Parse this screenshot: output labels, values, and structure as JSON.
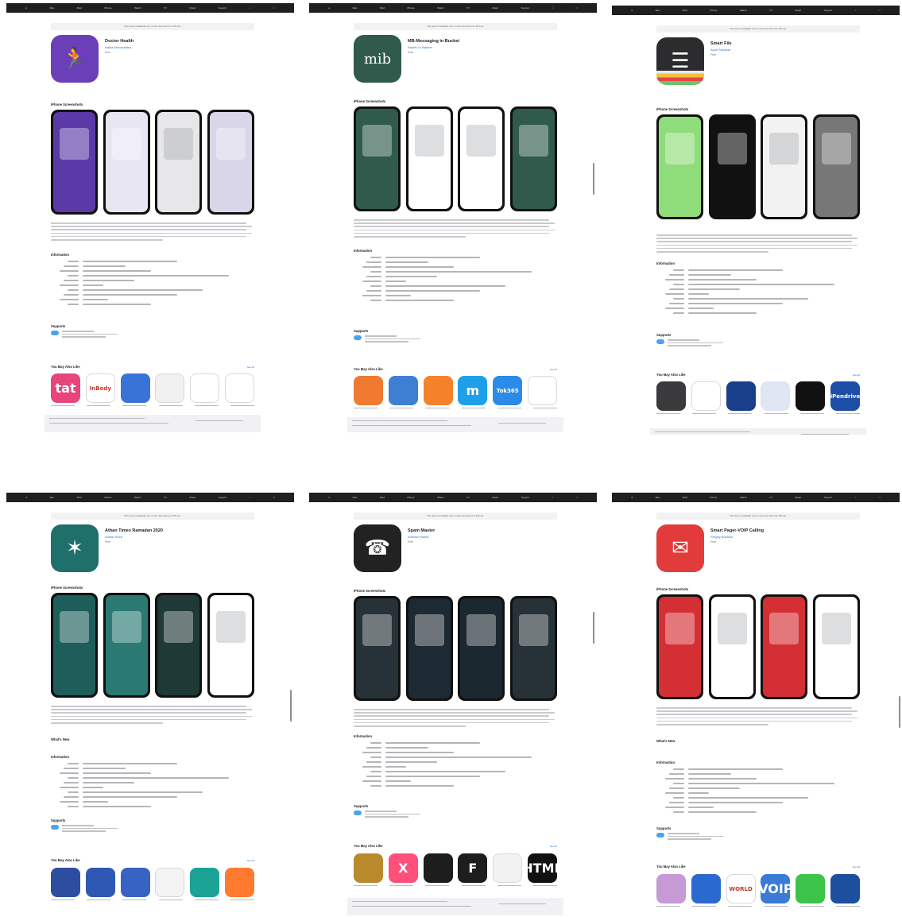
{
  "nav": [
    "",
    "Mac",
    "iPad",
    "iPhone",
    "Watch",
    "TV",
    "Music",
    "Support",
    "",
    ""
  ],
  "screenshots_heading": "iPhone Screenshots",
  "information_heading": "Information",
  "supports_heading": "Supports",
  "also_like_heading": "You May Also Like",
  "whats_new_heading": "What's New",
  "see_all": "See All",
  "panels": [
    {
      "banner": "This app is available only on the App Store for iPhone.",
      "title": "Doctor Health",
      "developer": "Haiaa Almowahiba",
      "price": "Free",
      "icon": "running-figure-icon",
      "icon_color": "#6b3fb8",
      "shot_colors": [
        "#5b3aa8",
        "#e9e6f3",
        "#e7e7ea",
        "#d9d6ea"
      ]
    },
    {
      "banner": "This app is available only on the App Store for iPhone.",
      "title": "MB-Messaging in Bucket",
      "developer": "Saheb Lo Bakeer",
      "price": "Free",
      "icon": "mib-logo-icon",
      "icon_color": "#2f5a4c",
      "shot_colors": [
        "#2f5a4c",
        "#ffffff",
        "#ffffff",
        "#2f5a4c"
      ]
    },
    {
      "banner": "This app is available only on the App Store for iPhone.",
      "title": "Smart File",
      "developer": "Ayub Sobahar",
      "price": "Free",
      "icon": "document-icon",
      "icon_color": "#2c2c2e",
      "shot_colors": [
        "#8fdc7a",
        "#111111",
        "#f2f2f2",
        "#777777"
      ]
    },
    {
      "banner": "This app is available only on the App Store for iPhone.",
      "title": "Athan Times Ramadan 2020",
      "developer": "Anwar Raza",
      "price": "Free",
      "icon": "compass-mosque-icon",
      "icon_color": "#1f6f6a",
      "shot_colors": [
        "#1e5e5a",
        "#2a7a73",
        "#1f3a36",
        "#ffffff"
      ]
    },
    {
      "banner": "This app is available only on the App Store for iPhone.",
      "title": "Spam Master",
      "developer": "Andrew Hamdi",
      "price": "Free",
      "icon": "phone-shield-icon",
      "icon_color": "#222222",
      "shot_colors": [
        "#263238",
        "#1e2a33",
        "#1c2830",
        "#263238"
      ]
    },
    {
      "banner": "This app is available only on the App Store for iPhone.",
      "title": "Smart Pager-VOIP Calling",
      "developer": "Sergey Bushkin",
      "price": "Free",
      "icon": "pager-phone-icon",
      "icon_color": "#e23b3b",
      "shot_colors": [
        "#d42f34",
        "#ffffff",
        "#d42f34",
        "#ffffff"
      ]
    }
  ],
  "also_like": [
    [
      {
        "name": "tat",
        "color": "#e8457b"
      },
      {
        "name": "InBody",
        "color": "#ffffff"
      },
      {
        "name": "",
        "color": "#3a73d8"
      },
      {
        "name": "",
        "color": "#f1f1f1"
      },
      {
        "name": "",
        "color": "#ffffff"
      },
      {
        "name": "",
        "color": "#ffffff"
      }
    ],
    [
      {
        "name": "",
        "color": "#f07a2f"
      },
      {
        "name": "",
        "color": "#3f7fd3"
      },
      {
        "name": "",
        "color": "#f4822a"
      },
      {
        "name": "m",
        "color": "#1ea0e8"
      },
      {
        "name": "Tok365",
        "color": "#2a8be8"
      },
      {
        "name": "",
        "color": "#ffffff"
      }
    ],
    [
      {
        "name": "",
        "color": "#3a3a3c"
      },
      {
        "name": "",
        "color": "#ffffff"
      },
      {
        "name": "",
        "color": "#1a3f8a"
      },
      {
        "name": "",
        "color": "#dfe7f2"
      },
      {
        "name": "",
        "color": "#111111"
      },
      {
        "name": "iPendrive",
        "color": "#1d4ea8"
      }
    ],
    [
      {
        "name": "",
        "color": "#2d4ea0"
      },
      {
        "name": "",
        "color": "#2f58b4"
      },
      {
        "name": "",
        "color": "#3763c2"
      },
      {
        "name": "",
        "color": "#f4f4f4"
      },
      {
        "name": "",
        "color": "#1aa396"
      },
      {
        "name": "",
        "color": "#ff7a2f"
      }
    ],
    [
      {
        "name": "",
        "color": "#b88a2c"
      },
      {
        "name": "X",
        "color": "#ff4f7a"
      },
      {
        "name": "",
        "color": "#1d1d1d"
      },
      {
        "name": "F",
        "color": "#1d1d1d"
      },
      {
        "name": "",
        "color": "#f2f2f2"
      },
      {
        "name": "HTML",
        "color": "#111111"
      }
    ],
    [
      {
        "name": "",
        "color": "#c79ad6"
      },
      {
        "name": "",
        "color": "#2a6ad0"
      },
      {
        "name": "WORLD",
        "color": "#ffffff"
      },
      {
        "name": "VOIP",
        "color": "#3a7bd5"
      },
      {
        "name": "",
        "color": "#3bc34a"
      },
      {
        "name": "",
        "color": "#1c4f9e"
      }
    ]
  ]
}
